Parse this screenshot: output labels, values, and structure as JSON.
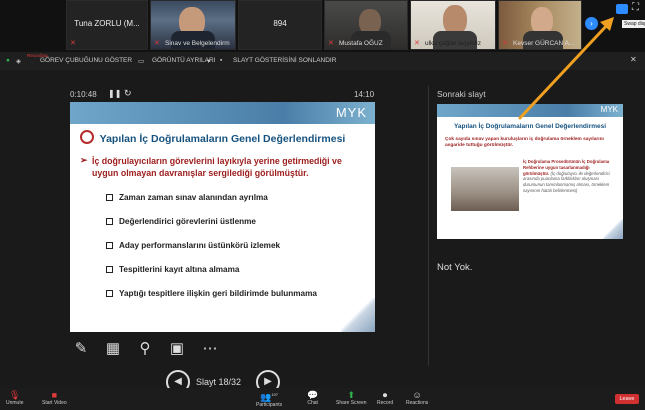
{
  "participants": [
    {
      "name": "Tuna ZORLU (M...",
      "type": "name"
    },
    {
      "name": "Sinav ve Belgelendirm",
      "type": "video"
    },
    {
      "name": "894",
      "type": "name"
    },
    {
      "name": "Mustafa OĞUZ",
      "type": "video"
    },
    {
      "name": "ulku çağlar laçyildiz",
      "type": "video"
    },
    {
      "name": "Kevser GÜRCAN A...",
      "type": "video"
    }
  ],
  "share_bar": {
    "taskbar": "GÖREV ÇUBUĞUNU GÖSTER",
    "display": "GÖRÜNTÜ AYRILARI",
    "end": "SLAYT GÖSTERİSİNİ SONLANDIR",
    "recording": "Recording",
    "tooltip": "Swap display"
  },
  "presenter": {
    "elapsed": "0:10:48",
    "clock": "14:10",
    "slide_counter": "Slayt 18/32",
    "next_label": "Sonraki slayt",
    "notes": "Not Yok."
  },
  "slide": {
    "logo": "MYK",
    "title": "Yapılan İç Doğrulamaların Genel Değerlendirmesi",
    "lead": "İç doğrulayıcıların görevlerini layıkıyla yerine getirmediği ve uygun olmayan davranışlar sergilediği görülmüştür.",
    "items": [
      "Zaman zaman sınav alanından ayrılma",
      "Değerlendirici görevlerini üstlenme",
      "Aday performanslarını üstünkörü izlemek",
      "Tespitlerini kayıt altına almama",
      "Yaptığı tespitlere ilişkin geri bildirimde bulunmama"
    ]
  },
  "next_slide": {
    "logo": "MYK",
    "title": "Yapılan İç Doğrulamaların Genel Değerlendirmesi",
    "lead": "Çok sayıda sınav yapan kuruluşların iç doğrulama örneklem sayılarını asgaride tuttuğu görülmüştür.",
    "col_main": "İç Doğrulama Prosedürünün İç Doğrulama Rehberine uygun tasarlanmadığı görülmüştür.",
    "col_italic": "(İç doğrulayıcı ile değerlendirici arasında puanlama farklılıkları oluşması durumunun tanımlanmamış olması, örneklem sayısının hatalı belirlenmesi)"
  },
  "bottom_toolbar": {
    "unmute": "Unmute",
    "start_video": "Start Video",
    "participants": "Participants",
    "participants_count": "197",
    "chat": "Chat",
    "share": "Share Screen",
    "record": "Record",
    "reactions": "Reactions",
    "leave": "Leave"
  },
  "colors": {
    "slide_title": "#16527f",
    "slide_lead": "#9d1c1c",
    "arrow": "#f0a020",
    "leave": "#d03030"
  }
}
